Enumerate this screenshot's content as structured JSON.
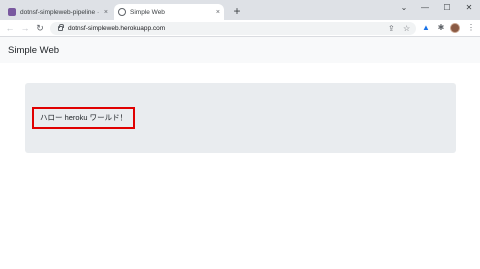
{
  "browser": {
    "tabs": [
      {
        "title": "dotnsf-simpleweb-pipeline · Pipe",
        "active": false,
        "favicon": "heroku-icon"
      },
      {
        "title": "Simple Web",
        "active": true,
        "favicon": "globe-icon"
      }
    ],
    "new_tab_glyph": "+",
    "tab_close_glyph": "×",
    "window_controls": {
      "dropdown": "⌄",
      "minimize": "—",
      "maximize": "☐",
      "close": "✕"
    },
    "nav": {
      "back": "←",
      "forward": "→",
      "reload": "↻"
    },
    "url": "dotnsf-simpleweb.herokuapp.com",
    "toolbar_icons": {
      "share": "⇪",
      "bookmark": "☆",
      "extension": "✱",
      "drive": "▲",
      "menu": "⋮"
    }
  },
  "page": {
    "brand": "Simple Web",
    "message": "ハロー heroku ワールド！"
  },
  "colors": {
    "highlight_border": "#e00000",
    "jumbotron_bg": "#e9ecef",
    "navbar_bg": "#f8f9fa",
    "tabstrip_bg": "#dee1e6"
  }
}
